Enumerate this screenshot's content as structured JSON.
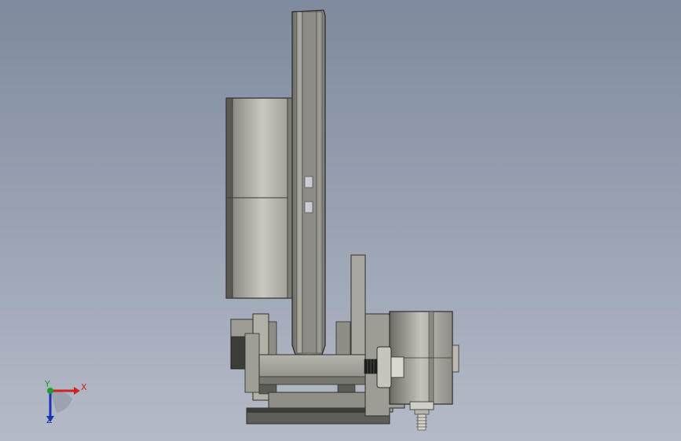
{
  "viewport": {
    "background_top": "#7f8a9e",
    "background_bottom": "#b4bbc8"
  },
  "model": {
    "assembly": "disc-brake-with-caliper",
    "parts": [
      "brake-disc",
      "wheel-hub",
      "caliper-bracket",
      "caliper-body",
      "piston-housing",
      "bleed-screw"
    ]
  },
  "triad": {
    "x_label": "X",
    "y_label": "Y",
    "z_label": "Z",
    "x_color": "#d42020",
    "y_color": "#1f9c2a",
    "z_color": "#2030b8"
  }
}
